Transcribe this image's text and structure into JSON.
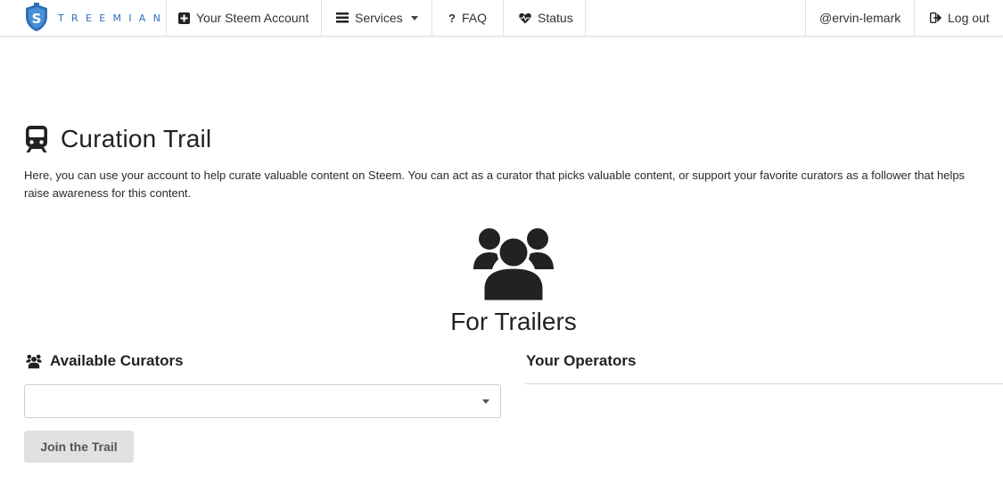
{
  "navbar": {
    "brand_text": "TREEMIAN",
    "items": [
      {
        "label": "Your Steem Account",
        "icon": "plus-square-icon"
      },
      {
        "label": "Services",
        "icon": "list-icon"
      },
      {
        "label": "FAQ",
        "icon": "question-icon"
      },
      {
        "label": "Status",
        "icon": "heartbeat-icon"
      }
    ],
    "user": "@ervin-lemark",
    "logout_label": "Log out"
  },
  "page": {
    "title": "Curation Trail",
    "intro": "Here, you can use your account to help curate valuable content on Steem. You can act as a curator that picks valuable content, or support your favorite curators as a follower that helps raise awareness for this content.",
    "section_title": "For Trailers"
  },
  "curators": {
    "heading": "Available Curators",
    "select_value": "",
    "join_label": "Join the Trail"
  },
  "operators": {
    "heading": "Your Operators"
  },
  "colors": {
    "brand_blue": "#2e6fb8",
    "button_bg": "#e0e1e2"
  }
}
